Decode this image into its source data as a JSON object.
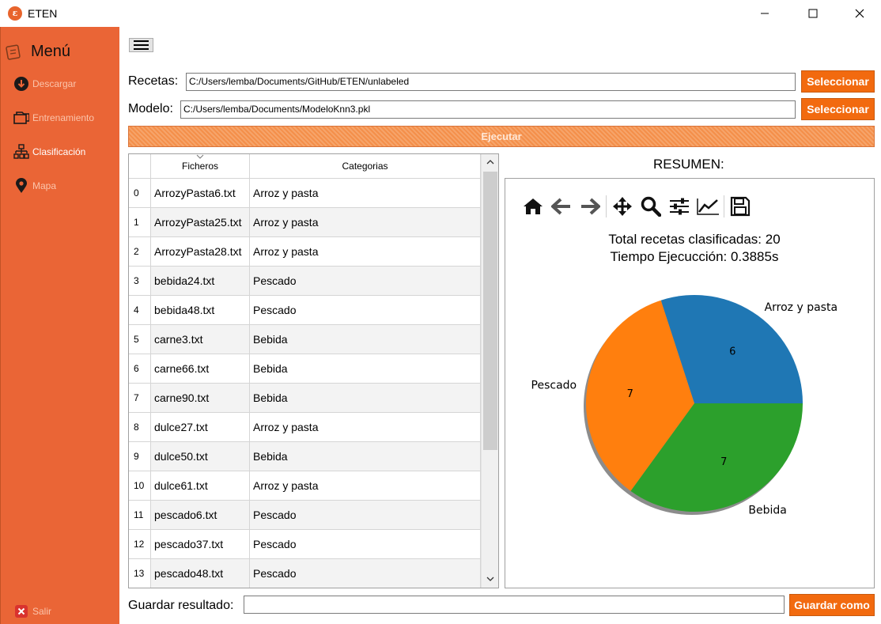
{
  "window": {
    "title": "ETEN",
    "logo_letter": "ε"
  },
  "sidebar": {
    "heading": "Menú",
    "items": [
      {
        "label": "Descargar",
        "icon": "download-icon",
        "active": false
      },
      {
        "label": "Entrenamiento",
        "icon": "folders-icon",
        "active": false
      },
      {
        "label": "Clasificación",
        "icon": "sitemap-icon",
        "active": true
      },
      {
        "label": "Mapa",
        "icon": "map-pin-icon",
        "active": false
      }
    ],
    "exit_label": "Salir"
  },
  "form": {
    "recetas_label": "Recetas:",
    "recetas_value": "C:/Users/lemba/Documents/GitHub/ETEN/unlabeled",
    "modelo_label": "Modelo:",
    "modelo_value": "C:/Users/lemba/Documents/ModeloKnn3.pkl",
    "select_label": "Seleccionar",
    "run_label": "Ejecutar"
  },
  "table": {
    "headers": [
      "Ficheros",
      "Categorias"
    ],
    "rows": [
      {
        "idx": "0",
        "file": "ArrozyPasta6.txt",
        "cat": "Arroz y pasta"
      },
      {
        "idx": "1",
        "file": "ArrozyPasta25.txt",
        "cat": "Arroz y pasta"
      },
      {
        "idx": "2",
        "file": "ArrozyPasta28.txt",
        "cat": "Arroz y pasta"
      },
      {
        "idx": "3",
        "file": "bebida24.txt",
        "cat": "Pescado"
      },
      {
        "idx": "4",
        "file": "bebida48.txt",
        "cat": "Pescado"
      },
      {
        "idx": "5",
        "file": "carne3.txt",
        "cat": "Bebida"
      },
      {
        "idx": "6",
        "file": "carne66.txt",
        "cat": "Bebida"
      },
      {
        "idx": "7",
        "file": "carne90.txt",
        "cat": "Bebida"
      },
      {
        "idx": "8",
        "file": "dulce27.txt",
        "cat": "Arroz y pasta"
      },
      {
        "idx": "9",
        "file": "dulce50.txt",
        "cat": "Bebida"
      },
      {
        "idx": "10",
        "file": "dulce61.txt",
        "cat": "Arroz y pasta"
      },
      {
        "idx": "11",
        "file": "pescado6.txt",
        "cat": "Pescado"
      },
      {
        "idx": "12",
        "file": "pescado37.txt",
        "cat": "Pescado"
      },
      {
        "idx": "13",
        "file": "pescado48.txt",
        "cat": "Pescado"
      }
    ]
  },
  "summary": {
    "heading": "RESUMEN:",
    "line1": "Total recetas clasificadas: 20",
    "line2": "Tiempo Ejecucción: 0.3885s",
    "toolbar_icons": [
      "home-icon",
      "back-arrow-icon",
      "forward-arrow-icon",
      "pan-icon",
      "zoom-icon",
      "configure-subplots-icon",
      "edit-axis-icon",
      "save-icon"
    ]
  },
  "chart_data": {
    "type": "pie",
    "categories": [
      "Arroz y pasta",
      "Pescado",
      "Bebida"
    ],
    "values": [
      6,
      7,
      7
    ],
    "colors": [
      "#1f77b4",
      "#ff7f0e",
      "#2ca02c"
    ],
    "start_angle_deg": 0,
    "shadow": true,
    "title": ""
  },
  "footer": {
    "save_label": "Guardar resultado:",
    "save_value": "",
    "save_button": "Guardar como"
  }
}
